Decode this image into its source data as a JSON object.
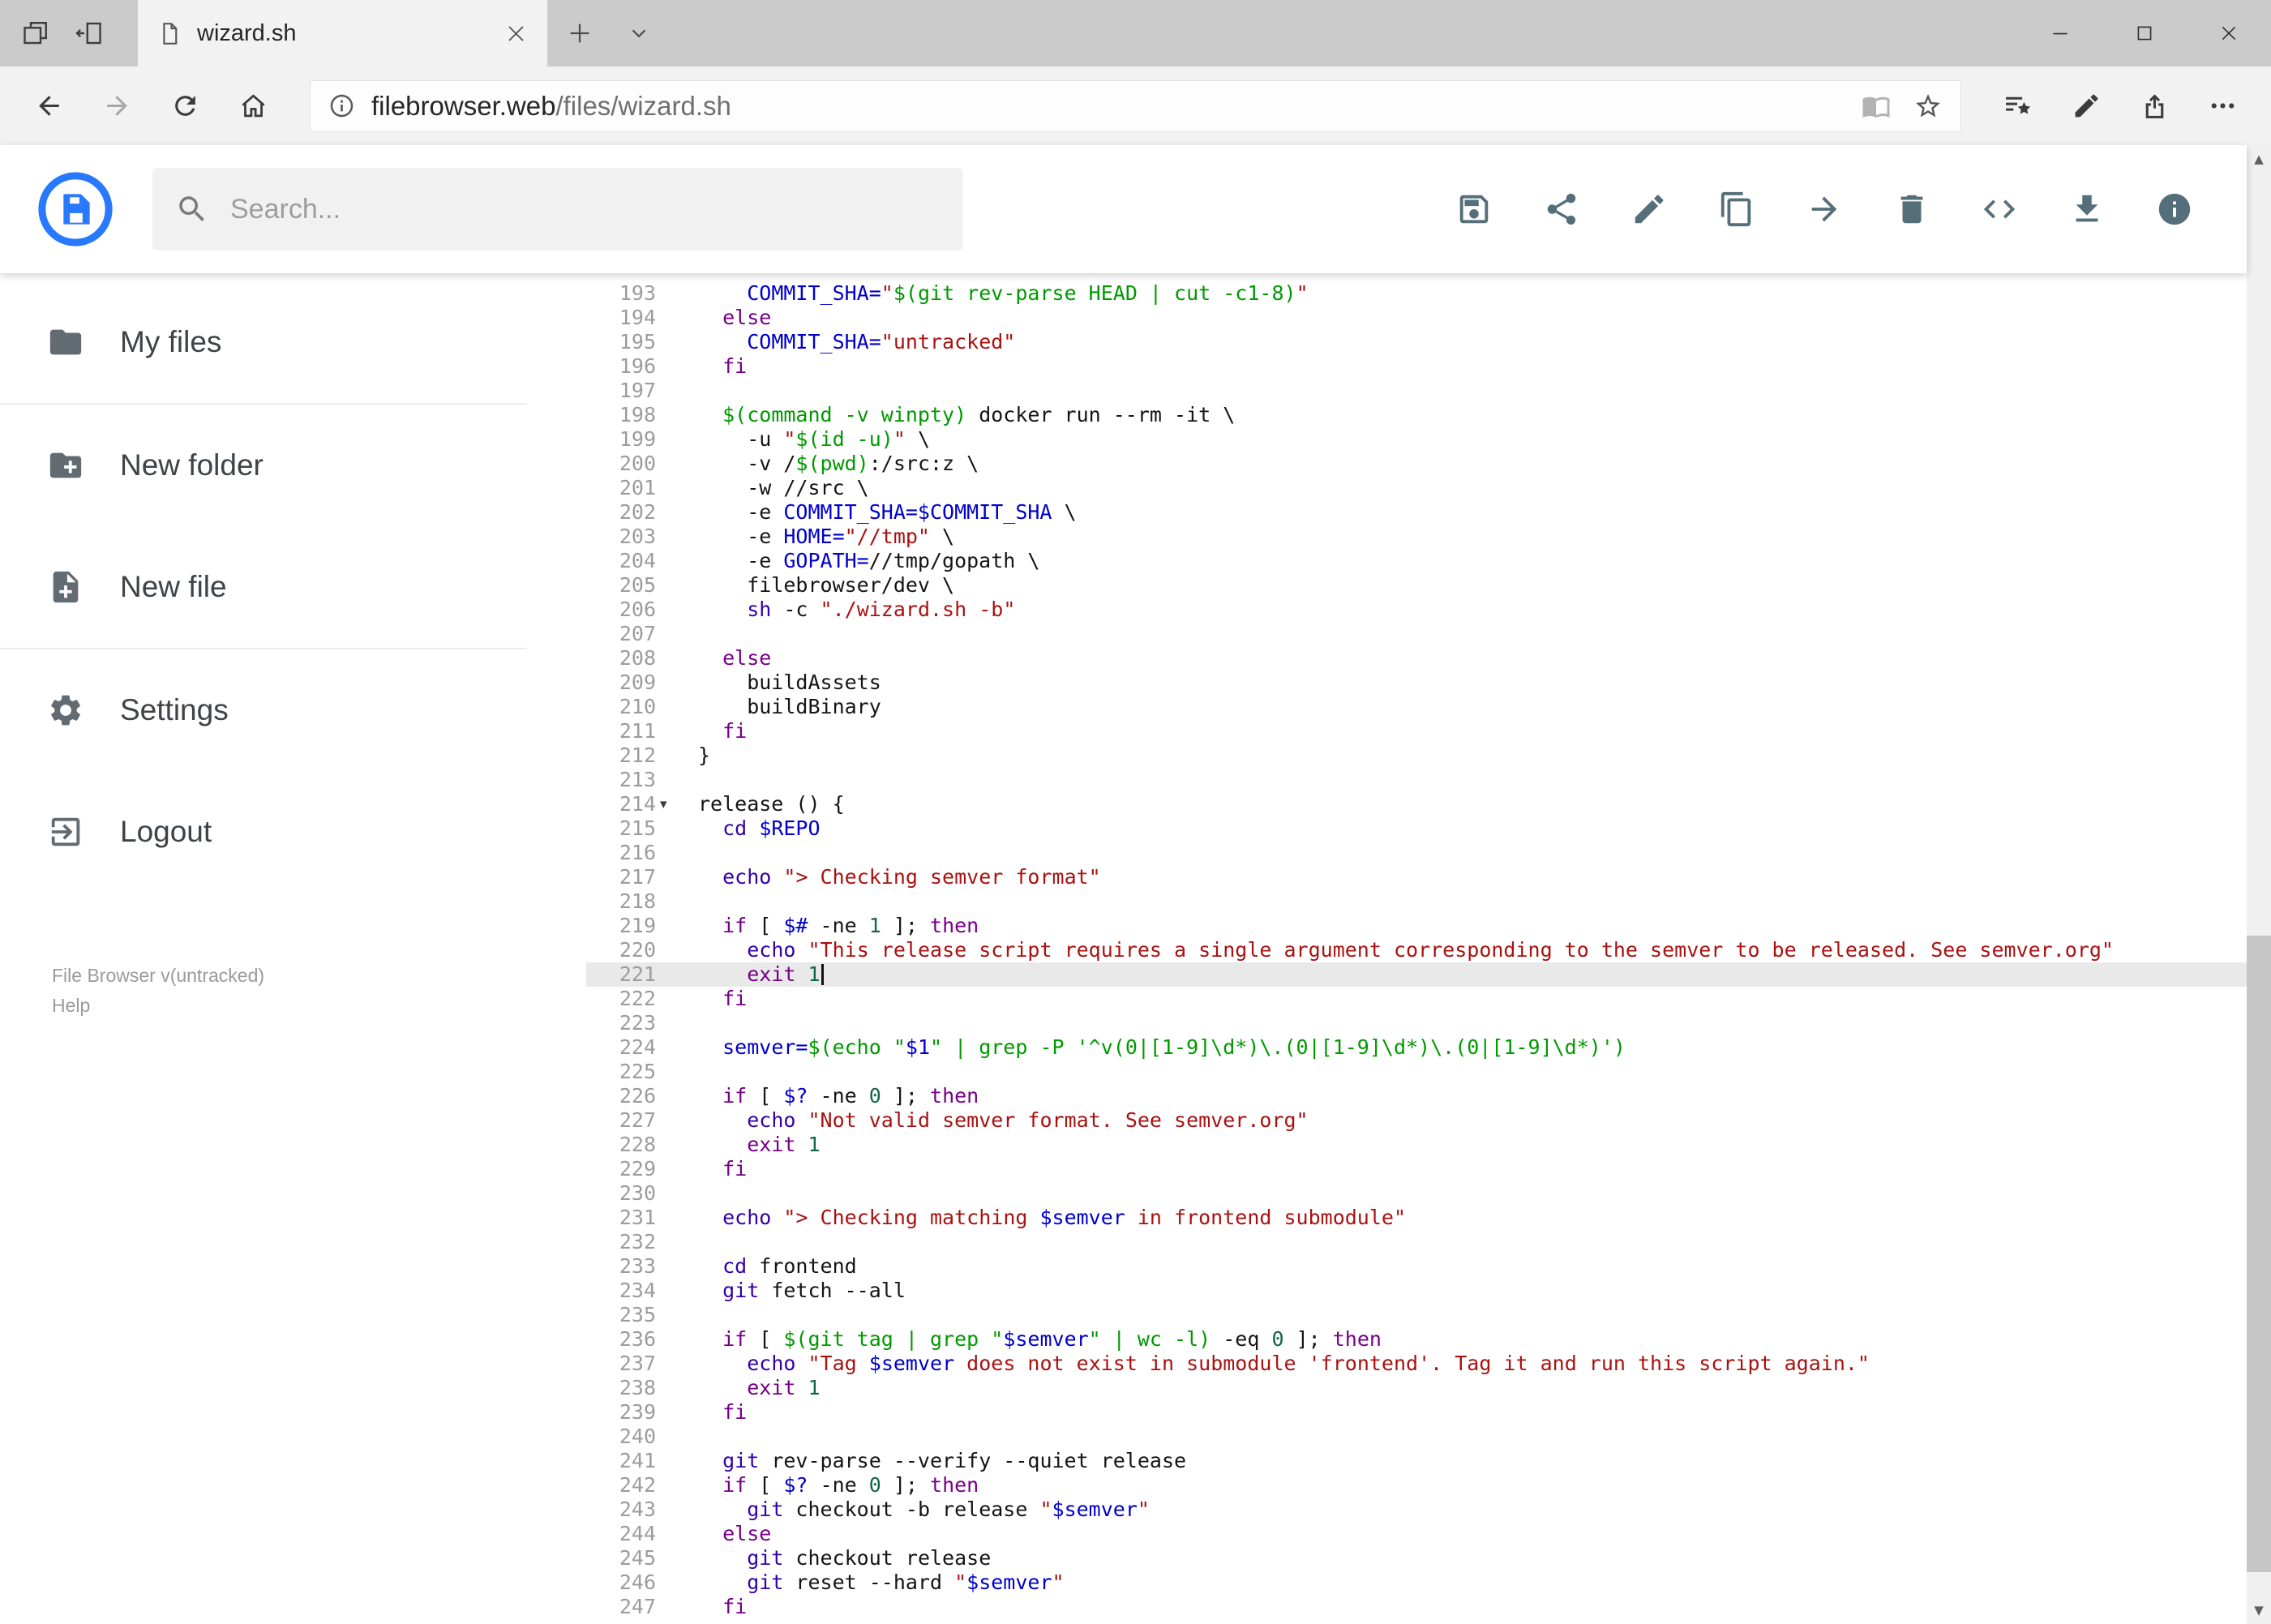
{
  "browser": {
    "tab_bar_icons": [
      "show-set-aside-tabs",
      "set-tabs-aside"
    ],
    "tab_title": "wizard.sh",
    "window_icons": [
      "minimize",
      "maximize",
      "close"
    ],
    "nav_icons": [
      "back",
      "forward",
      "refresh",
      "home"
    ],
    "url_domain": "filebrowser.web",
    "url_path": "/files/wizard.sh",
    "address_icons": [
      "reading-view",
      "favorite-star"
    ],
    "right_icons": [
      "hub",
      "annotate-pen",
      "share-page",
      "more"
    ]
  },
  "app": {
    "search_placeholder": "Search...",
    "toolbar": [
      "save",
      "share",
      "edit",
      "copy",
      "move",
      "delete",
      "code",
      "download",
      "info"
    ]
  },
  "sidebar": {
    "items": [
      {
        "label": "My files",
        "icon": "folder"
      },
      {
        "label": "New folder",
        "icon": "folder-plus"
      },
      {
        "label": "New file",
        "icon": "file-plus"
      },
      {
        "label": "Settings",
        "icon": "gear"
      },
      {
        "label": "Logout",
        "icon": "logout"
      }
    ],
    "dividers_after": [
      0,
      2
    ],
    "footer_version": "File Browser v(untracked)",
    "footer_help": "Help"
  },
  "scrollbar": {
    "up_glyph": "▲",
    "down_glyph": "▼"
  },
  "editor": {
    "language": "shell",
    "active_line": 221,
    "cursor_line": 221,
    "fold_line": 214,
    "fold_glyph": "▾",
    "colors": {
      "keyword": "#770088",
      "string": "#aa1111",
      "definition": "#0000cc",
      "quote": "#009900",
      "builtin": "#3300aa",
      "number": "#116644"
    },
    "lines": [
      {
        "no": 193,
        "t": [
          [
            "p",
            "    "
          ],
          [
            "v",
            "COMMIT_SHA="
          ],
          [
            "s",
            "\""
          ],
          [
            "q",
            "$(git rev-parse HEAD | cut -c1-8)"
          ],
          [
            "s",
            "\""
          ]
        ]
      },
      {
        "no": 194,
        "t": [
          [
            "p",
            "  "
          ],
          [
            "k",
            "else"
          ]
        ]
      },
      {
        "no": 195,
        "t": [
          [
            "p",
            "    "
          ],
          [
            "v",
            "COMMIT_SHA="
          ],
          [
            "s",
            "\"untracked\""
          ]
        ]
      },
      {
        "no": 196,
        "t": [
          [
            "p",
            "  "
          ],
          [
            "k",
            "fi"
          ]
        ]
      },
      {
        "no": 197,
        "t": []
      },
      {
        "no": 198,
        "t": [
          [
            "p",
            "  "
          ],
          [
            "q",
            "$(command -v winpty)"
          ],
          [
            "p",
            " docker run --rm -it \\"
          ]
        ]
      },
      {
        "no": 199,
        "t": [
          [
            "p",
            "    -u "
          ],
          [
            "s",
            "\""
          ],
          [
            "q",
            "$(id -u)"
          ],
          [
            "s",
            "\""
          ],
          [
            "p",
            " \\"
          ]
        ]
      },
      {
        "no": 200,
        "t": [
          [
            "p",
            "    -v /"
          ],
          [
            "q",
            "$(pwd)"
          ],
          [
            "p",
            ":/src:z \\"
          ]
        ]
      },
      {
        "no": 201,
        "t": [
          [
            "p",
            "    -w //src \\"
          ]
        ]
      },
      {
        "no": 202,
        "t": [
          [
            "p",
            "    -e "
          ],
          [
            "v",
            "COMMIT_SHA=$COMMIT_SHA"
          ],
          [
            "p",
            " \\"
          ]
        ]
      },
      {
        "no": 203,
        "t": [
          [
            "p",
            "    -e "
          ],
          [
            "v",
            "HOME="
          ],
          [
            "s",
            "\"//tmp\""
          ],
          [
            "p",
            " \\"
          ]
        ]
      },
      {
        "no": 204,
        "t": [
          [
            "p",
            "    -e "
          ],
          [
            "v",
            "GOPATH="
          ],
          [
            "p",
            "//tmp/gopath \\"
          ]
        ]
      },
      {
        "no": 205,
        "t": [
          [
            "p",
            "    filebrowser/dev \\"
          ]
        ]
      },
      {
        "no": 206,
        "t": [
          [
            "p",
            "    "
          ],
          [
            "b",
            "sh"
          ],
          [
            "p",
            " -c "
          ],
          [
            "s",
            "\"./wizard.sh -b\""
          ]
        ]
      },
      {
        "no": 207,
        "t": []
      },
      {
        "no": 208,
        "t": [
          [
            "p",
            "  "
          ],
          [
            "k",
            "else"
          ]
        ]
      },
      {
        "no": 209,
        "t": [
          [
            "p",
            "    buildAssets"
          ]
        ]
      },
      {
        "no": 210,
        "t": [
          [
            "p",
            "    buildBinary"
          ]
        ]
      },
      {
        "no": 211,
        "t": [
          [
            "p",
            "  "
          ],
          [
            "k",
            "fi"
          ]
        ]
      },
      {
        "no": 212,
        "t": [
          [
            "p",
            "}"
          ]
        ]
      },
      {
        "no": 213,
        "t": []
      },
      {
        "no": 214,
        "t": [
          [
            "p",
            "release () {"
          ]
        ]
      },
      {
        "no": 215,
        "t": [
          [
            "p",
            "  "
          ],
          [
            "b",
            "cd"
          ],
          [
            "p",
            " "
          ],
          [
            "v",
            "$REPO"
          ]
        ]
      },
      {
        "no": 216,
        "t": []
      },
      {
        "no": 217,
        "t": [
          [
            "p",
            "  "
          ],
          [
            "b",
            "echo"
          ],
          [
            "p",
            " "
          ],
          [
            "s",
            "\"> Checking semver format\""
          ]
        ]
      },
      {
        "no": 218,
        "t": []
      },
      {
        "no": 219,
        "t": [
          [
            "p",
            "  "
          ],
          [
            "k",
            "if"
          ],
          [
            "p",
            " [ "
          ],
          [
            "v",
            "$#"
          ],
          [
            "p",
            " -ne "
          ],
          [
            "n",
            "1"
          ],
          [
            "p",
            " ]; "
          ],
          [
            "k",
            "then"
          ]
        ]
      },
      {
        "no": 220,
        "t": [
          [
            "p",
            "    "
          ],
          [
            "b",
            "echo"
          ],
          [
            "p",
            " "
          ],
          [
            "s",
            "\"This release script requires a single argument corresponding to the semver to be released. See semver.org\""
          ]
        ]
      },
      {
        "no": 221,
        "t": [
          [
            "p",
            "    "
          ],
          [
            "k",
            "exit"
          ],
          [
            "p",
            " "
          ],
          [
            "n",
            "1"
          ]
        ]
      },
      {
        "no": 222,
        "t": [
          [
            "p",
            "  "
          ],
          [
            "k",
            "fi"
          ]
        ]
      },
      {
        "no": 223,
        "t": []
      },
      {
        "no": 224,
        "t": [
          [
            "p",
            "  "
          ],
          [
            "v",
            "semver="
          ],
          [
            "q",
            "$(echo \""
          ],
          [
            "v",
            "$1"
          ],
          [
            "q",
            "\" | grep -P '^v(0|[1-9]\\d*)\\.(0|[1-9]\\d*)\\.(0|[1-9]\\d*)')"
          ]
        ]
      },
      {
        "no": 225,
        "t": []
      },
      {
        "no": 226,
        "t": [
          [
            "p",
            "  "
          ],
          [
            "k",
            "if"
          ],
          [
            "p",
            " [ "
          ],
          [
            "v",
            "$?"
          ],
          [
            "p",
            " -ne "
          ],
          [
            "n",
            "0"
          ],
          [
            "p",
            " ]; "
          ],
          [
            "k",
            "then"
          ]
        ]
      },
      {
        "no": 227,
        "t": [
          [
            "p",
            "    "
          ],
          [
            "b",
            "echo"
          ],
          [
            "p",
            " "
          ],
          [
            "s",
            "\"Not valid semver format. See semver.org\""
          ]
        ]
      },
      {
        "no": 228,
        "t": [
          [
            "p",
            "    "
          ],
          [
            "k",
            "exit"
          ],
          [
            "p",
            " "
          ],
          [
            "n",
            "1"
          ]
        ]
      },
      {
        "no": 229,
        "t": [
          [
            "p",
            "  "
          ],
          [
            "k",
            "fi"
          ]
        ]
      },
      {
        "no": 230,
        "t": []
      },
      {
        "no": 231,
        "t": [
          [
            "p",
            "  "
          ],
          [
            "b",
            "echo"
          ],
          [
            "p",
            " "
          ],
          [
            "s",
            "\"> Checking matching "
          ],
          [
            "v",
            "$semver"
          ],
          [
            "s",
            " in frontend submodule\""
          ]
        ]
      },
      {
        "no": 232,
        "t": []
      },
      {
        "no": 233,
        "t": [
          [
            "p",
            "  "
          ],
          [
            "b",
            "cd"
          ],
          [
            "p",
            " frontend"
          ]
        ]
      },
      {
        "no": 234,
        "t": [
          [
            "p",
            "  "
          ],
          [
            "b",
            "git"
          ],
          [
            "p",
            " fetch --all"
          ]
        ]
      },
      {
        "no": 235,
        "t": []
      },
      {
        "no": 236,
        "t": [
          [
            "p",
            "  "
          ],
          [
            "k",
            "if"
          ],
          [
            "p",
            " [ "
          ],
          [
            "q",
            "$(git tag | grep \""
          ],
          [
            "v",
            "$semver"
          ],
          [
            "q",
            "\" | wc -l)"
          ],
          [
            "p",
            " -eq "
          ],
          [
            "n",
            "0"
          ],
          [
            "p",
            " ]; "
          ],
          [
            "k",
            "then"
          ]
        ]
      },
      {
        "no": 237,
        "t": [
          [
            "p",
            "    "
          ],
          [
            "b",
            "echo"
          ],
          [
            "p",
            " "
          ],
          [
            "s",
            "\"Tag "
          ],
          [
            "v",
            "$semver"
          ],
          [
            "s",
            " does not exist in submodule 'frontend'. Tag it and run this script again.\""
          ]
        ]
      },
      {
        "no": 238,
        "t": [
          [
            "p",
            "    "
          ],
          [
            "k",
            "exit"
          ],
          [
            "p",
            " "
          ],
          [
            "n",
            "1"
          ]
        ]
      },
      {
        "no": 239,
        "t": [
          [
            "p",
            "  "
          ],
          [
            "k",
            "fi"
          ]
        ]
      },
      {
        "no": 240,
        "t": []
      },
      {
        "no": 241,
        "t": [
          [
            "p",
            "  "
          ],
          [
            "b",
            "git"
          ],
          [
            "p",
            " rev-parse --verify --quiet release"
          ]
        ]
      },
      {
        "no": 242,
        "t": [
          [
            "p",
            "  "
          ],
          [
            "k",
            "if"
          ],
          [
            "p",
            " [ "
          ],
          [
            "v",
            "$?"
          ],
          [
            "p",
            " -ne "
          ],
          [
            "n",
            "0"
          ],
          [
            "p",
            " ]; "
          ],
          [
            "k",
            "then"
          ]
        ]
      },
      {
        "no": 243,
        "t": [
          [
            "p",
            "    "
          ],
          [
            "b",
            "git"
          ],
          [
            "p",
            " checkout -b release "
          ],
          [
            "s",
            "\""
          ],
          [
            "v",
            "$semver"
          ],
          [
            "s",
            "\""
          ]
        ]
      },
      {
        "no": 244,
        "t": [
          [
            "p",
            "  "
          ],
          [
            "k",
            "else"
          ]
        ]
      },
      {
        "no": 245,
        "t": [
          [
            "p",
            "    "
          ],
          [
            "b",
            "git"
          ],
          [
            "p",
            " checkout release"
          ]
        ]
      },
      {
        "no": 246,
        "t": [
          [
            "p",
            "    "
          ],
          [
            "b",
            "git"
          ],
          [
            "p",
            " reset --hard "
          ],
          [
            "s",
            "\""
          ],
          [
            "v",
            "$semver"
          ],
          [
            "s",
            "\""
          ]
        ]
      },
      {
        "no": 247,
        "t": [
          [
            "p",
            "  "
          ],
          [
            "k",
            "fi"
          ]
        ]
      }
    ]
  }
}
